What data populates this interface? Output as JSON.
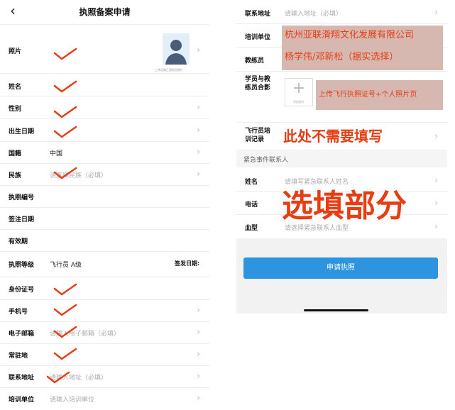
{
  "colors": {
    "accent": "#2d95e0",
    "annotation_red": "#e83d12",
    "note_bg": "#d6b8b1"
  },
  "left": {
    "back_icon": "chevron-left-icon",
    "title": "执照备案申请",
    "photo_label": "照片",
    "photo_hint": "上传近期正面免冠照片",
    "fields": {
      "name": "姓名",
      "gender": "性别",
      "birth": "出生日期",
      "nationality": "国籍",
      "nationality_value": "中国",
      "ethnicity": "民族",
      "ethnicity_placeholder": "请选择民族（必填）",
      "license_no": "执照编号",
      "sign_date": "签注日期",
      "validity": "有效期",
      "license_level": "执照等级",
      "license_level_value": "飞行员  A级",
      "issue_date": "签发日期:",
      "id_no": "身份证号",
      "phone": "手机号",
      "email": "电子邮箱",
      "email_placeholder": "请输入电子邮箱（必填）",
      "residence": "常驻地",
      "address": "联系地址",
      "address_placeholder": "请输入地址（必填）",
      "training_unit": "培训单位",
      "training_unit_placeholder": "请输入培训单位"
    }
  },
  "right": {
    "address": "联系地址",
    "address_placeholder": "请输入地址（必填）",
    "training_unit": "培训单位",
    "training_unit_note": "杭州亚联滑翔文化发展有限公司",
    "coach": "教练员",
    "coach_note": "杨学伟/邓新松（据实选择）",
    "group_photo": "学员与教练员合影",
    "add_photo_caption": "添加照片",
    "group_photo_note": "上传飞行执照证号+个人照片页",
    "training_record": "飞行员培训记录",
    "training_record_note": "此处不需要填写",
    "emergency_section": "紧急事件联系人",
    "emergency_name": "姓名",
    "emergency_name_placeholder": "请填写紧急联系人姓名",
    "emergency_phone": "电话",
    "emergency_blood": "血型",
    "emergency_blood_placeholder": "请选择紧急联系人血型",
    "optional_note": "选填部分",
    "submit": "申请执照"
  }
}
